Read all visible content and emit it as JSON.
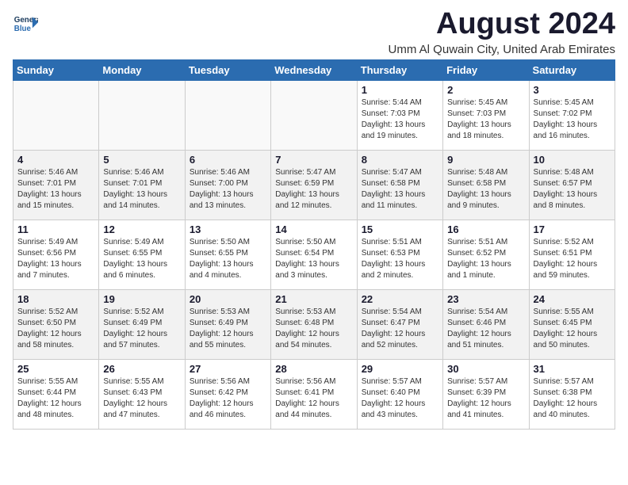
{
  "logo": {
    "line1": "General",
    "line2": "Blue"
  },
  "header": {
    "month_year": "August 2024",
    "location": "Umm Al Quwain City, United Arab Emirates"
  },
  "weekdays": [
    "Sunday",
    "Monday",
    "Tuesday",
    "Wednesday",
    "Thursday",
    "Friday",
    "Saturday"
  ],
  "weeks": [
    [
      {
        "day": "",
        "info": ""
      },
      {
        "day": "",
        "info": ""
      },
      {
        "day": "",
        "info": ""
      },
      {
        "day": "",
        "info": ""
      },
      {
        "day": "1",
        "info": "Sunrise: 5:44 AM\nSunset: 7:03 PM\nDaylight: 13 hours\nand 19 minutes."
      },
      {
        "day": "2",
        "info": "Sunrise: 5:45 AM\nSunset: 7:03 PM\nDaylight: 13 hours\nand 18 minutes."
      },
      {
        "day": "3",
        "info": "Sunrise: 5:45 AM\nSunset: 7:02 PM\nDaylight: 13 hours\nand 16 minutes."
      }
    ],
    [
      {
        "day": "4",
        "info": "Sunrise: 5:46 AM\nSunset: 7:01 PM\nDaylight: 13 hours\nand 15 minutes."
      },
      {
        "day": "5",
        "info": "Sunrise: 5:46 AM\nSunset: 7:01 PM\nDaylight: 13 hours\nand 14 minutes."
      },
      {
        "day": "6",
        "info": "Sunrise: 5:46 AM\nSunset: 7:00 PM\nDaylight: 13 hours\nand 13 minutes."
      },
      {
        "day": "7",
        "info": "Sunrise: 5:47 AM\nSunset: 6:59 PM\nDaylight: 13 hours\nand 12 minutes."
      },
      {
        "day": "8",
        "info": "Sunrise: 5:47 AM\nSunset: 6:58 PM\nDaylight: 13 hours\nand 11 minutes."
      },
      {
        "day": "9",
        "info": "Sunrise: 5:48 AM\nSunset: 6:58 PM\nDaylight: 13 hours\nand 9 minutes."
      },
      {
        "day": "10",
        "info": "Sunrise: 5:48 AM\nSunset: 6:57 PM\nDaylight: 13 hours\nand 8 minutes."
      }
    ],
    [
      {
        "day": "11",
        "info": "Sunrise: 5:49 AM\nSunset: 6:56 PM\nDaylight: 13 hours\nand 7 minutes."
      },
      {
        "day": "12",
        "info": "Sunrise: 5:49 AM\nSunset: 6:55 PM\nDaylight: 13 hours\nand 6 minutes."
      },
      {
        "day": "13",
        "info": "Sunrise: 5:50 AM\nSunset: 6:55 PM\nDaylight: 13 hours\nand 4 minutes."
      },
      {
        "day": "14",
        "info": "Sunrise: 5:50 AM\nSunset: 6:54 PM\nDaylight: 13 hours\nand 3 minutes."
      },
      {
        "day": "15",
        "info": "Sunrise: 5:51 AM\nSunset: 6:53 PM\nDaylight: 13 hours\nand 2 minutes."
      },
      {
        "day": "16",
        "info": "Sunrise: 5:51 AM\nSunset: 6:52 PM\nDaylight: 13 hours\nand 1 minute."
      },
      {
        "day": "17",
        "info": "Sunrise: 5:52 AM\nSunset: 6:51 PM\nDaylight: 12 hours\nand 59 minutes."
      }
    ],
    [
      {
        "day": "18",
        "info": "Sunrise: 5:52 AM\nSunset: 6:50 PM\nDaylight: 12 hours\nand 58 minutes."
      },
      {
        "day": "19",
        "info": "Sunrise: 5:52 AM\nSunset: 6:49 PM\nDaylight: 12 hours\nand 57 minutes."
      },
      {
        "day": "20",
        "info": "Sunrise: 5:53 AM\nSunset: 6:49 PM\nDaylight: 12 hours\nand 55 minutes."
      },
      {
        "day": "21",
        "info": "Sunrise: 5:53 AM\nSunset: 6:48 PM\nDaylight: 12 hours\nand 54 minutes."
      },
      {
        "day": "22",
        "info": "Sunrise: 5:54 AM\nSunset: 6:47 PM\nDaylight: 12 hours\nand 52 minutes."
      },
      {
        "day": "23",
        "info": "Sunrise: 5:54 AM\nSunset: 6:46 PM\nDaylight: 12 hours\nand 51 minutes."
      },
      {
        "day": "24",
        "info": "Sunrise: 5:55 AM\nSunset: 6:45 PM\nDaylight: 12 hours\nand 50 minutes."
      }
    ],
    [
      {
        "day": "25",
        "info": "Sunrise: 5:55 AM\nSunset: 6:44 PM\nDaylight: 12 hours\nand 48 minutes."
      },
      {
        "day": "26",
        "info": "Sunrise: 5:55 AM\nSunset: 6:43 PM\nDaylight: 12 hours\nand 47 minutes."
      },
      {
        "day": "27",
        "info": "Sunrise: 5:56 AM\nSunset: 6:42 PM\nDaylight: 12 hours\nand 46 minutes."
      },
      {
        "day": "28",
        "info": "Sunrise: 5:56 AM\nSunset: 6:41 PM\nDaylight: 12 hours\nand 44 minutes."
      },
      {
        "day": "29",
        "info": "Sunrise: 5:57 AM\nSunset: 6:40 PM\nDaylight: 12 hours\nand 43 minutes."
      },
      {
        "day": "30",
        "info": "Sunrise: 5:57 AM\nSunset: 6:39 PM\nDaylight: 12 hours\nand 41 minutes."
      },
      {
        "day": "31",
        "info": "Sunrise: 5:57 AM\nSunset: 6:38 PM\nDaylight: 12 hours\nand 40 minutes."
      }
    ]
  ]
}
